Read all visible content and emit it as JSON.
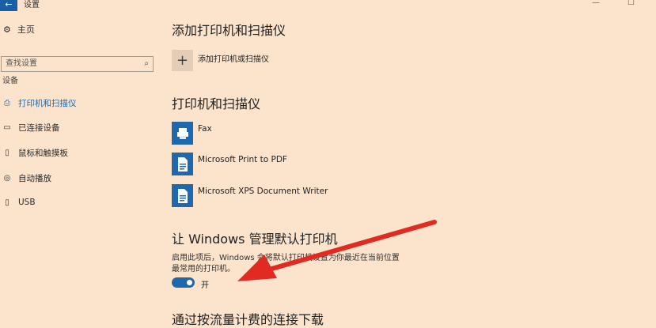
{
  "window": {
    "title": "设置",
    "back_icon": "←",
    "controls": {
      "minimize": "—",
      "maximize": "☐"
    }
  },
  "sidebar": {
    "home_label": "主页",
    "search_placeholder": "查找设置",
    "section_label": "设备",
    "items": [
      {
        "label": "打印机和扫描仪",
        "icon": "printer-icon",
        "glyph": "⎙",
        "active": true
      },
      {
        "label": "已连接设备",
        "icon": "connected-devices-icon",
        "glyph": "▭",
        "active": false
      },
      {
        "label": "鼠标和触摸板",
        "icon": "mouse-icon",
        "glyph": "▯",
        "active": false
      },
      {
        "label": "自动播放",
        "icon": "autoplay-icon",
        "glyph": "◎",
        "active": false
      },
      {
        "label": "USB",
        "icon": "usb-icon",
        "glyph": "▯",
        "active": false
      }
    ]
  },
  "main": {
    "add_heading": "添加打印机和扫描仪",
    "add_button_label": "添加打印机或扫描仪",
    "printers_heading": "打印机和扫描仪",
    "printers": [
      {
        "name": "Fax",
        "icon": "fax-icon"
      },
      {
        "name": "Microsoft Print to PDF",
        "icon": "pdf-printer-icon"
      },
      {
        "name": "Microsoft XPS Document Writer",
        "icon": "xps-printer-icon"
      }
    ],
    "default_heading": "让 Windows 管理默认打印机",
    "default_desc_line1": "启用此项后，Windows 会将默认打印机设置为你最近在当前位置",
    "default_desc_line2": "最常用的打印机。",
    "toggle_state": "开",
    "metered_heading": "通过按流量计费的连接下载"
  },
  "annotation": {
    "arrow_color": "#e02a22"
  },
  "colors": {
    "background": "#fbe3cc",
    "accent": "#1f68ad"
  }
}
